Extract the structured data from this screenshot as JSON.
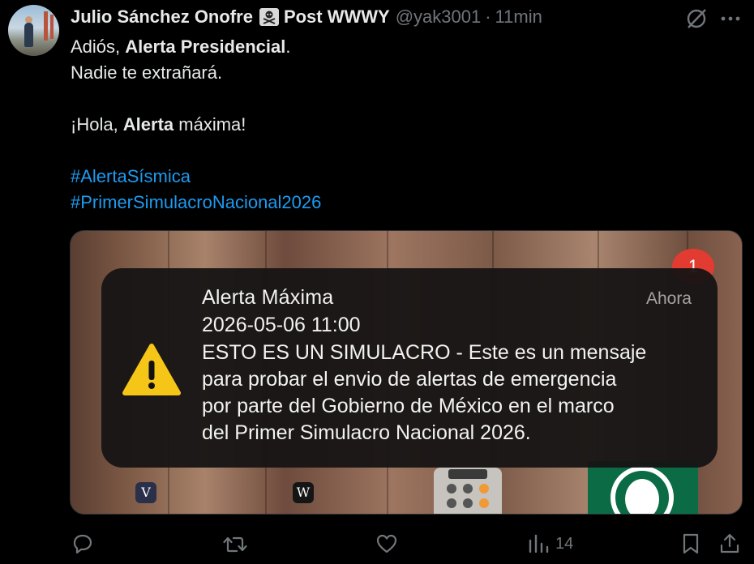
{
  "tweet": {
    "author_name": "Julio Sánchez Onofre",
    "author_suffix": "Post WWWY",
    "handle": "@yak3001",
    "separator": "·",
    "time": "11min",
    "line1_pre": "Adiós, ",
    "line1_bold": "Alerta Presidencial",
    "line1_post": ".",
    "line2": "Nadie te extrañará.",
    "line3_pre": "¡Hola, ",
    "line3_bold": "Alerta",
    "line3_post": " máxima!",
    "hashtag1": "#AlertaSísmica",
    "hashtag2": "#PrimerSimulacroNacional2026"
  },
  "media": {
    "badge_count": "1",
    "notification": {
      "title": "Alerta Máxima",
      "timestamp": "Ahora",
      "date": "2026-05-06 11:00",
      "body_lines": [
        "ESTO ES UN SIMULACRO - Este es un mensaje",
        "para probar el envio de alertas de emergencia",
        "por parte del Gobierno de México en el marco",
        "del Primer Simulacro Nacional 2026."
      ]
    },
    "app_letters": [
      "V",
      "W"
    ]
  },
  "actions": {
    "views_count": "14"
  },
  "colors": {
    "background": "#000000",
    "text": "#e7e9ea",
    "muted": "#71767b",
    "link": "#1d9bf0",
    "badge_red": "#e23b32",
    "warning_yellow": "#f5c518"
  },
  "icons": [
    "skull-crossbones-icon",
    "grok-icon",
    "more-icon",
    "warning-icon",
    "reply-icon",
    "retweet-icon",
    "like-icon",
    "views-icon",
    "bookmark-icon",
    "share-icon"
  ]
}
